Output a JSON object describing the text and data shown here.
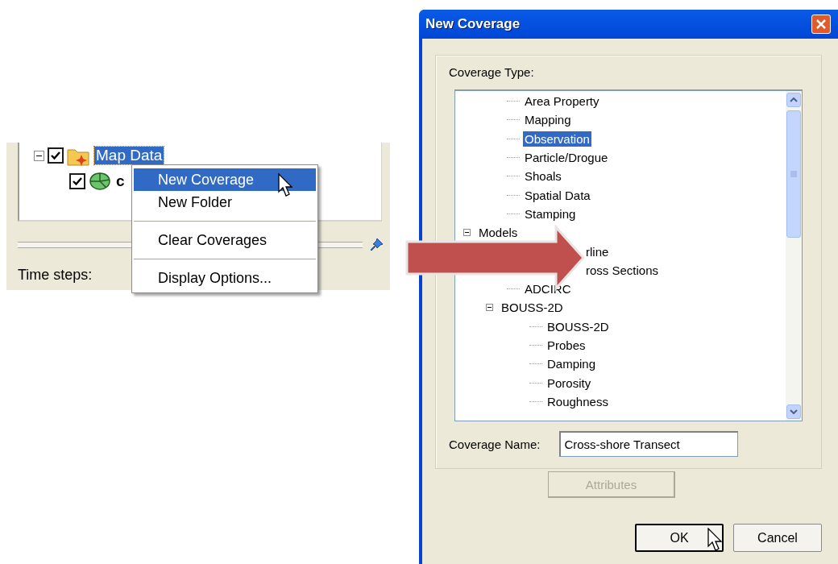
{
  "project_tree": [
    {
      "label": "Map Data",
      "checked": true,
      "selected": true,
      "expanded": true,
      "children": [
        {
          "label": "c",
          "checked": true
        }
      ]
    }
  ],
  "context_menu": {
    "groups": [
      [
        {
          "label": "New Coverage",
          "selected": true
        },
        {
          "label": "New Folder",
          "selected": false
        }
      ],
      [
        {
          "label": "Clear Coverages",
          "selected": false
        }
      ],
      [
        {
          "label": "Display Options...",
          "selected": false
        }
      ]
    ]
  },
  "time_steps_label": "Time steps:",
  "dialog": {
    "title": "New Coverage",
    "coverage_type_label": "Coverage Type:",
    "tree": {
      "scrolled_group": [
        {
          "label": "Area Property",
          "selected": false,
          "kind": "plain"
        },
        {
          "label": "Mapping",
          "selected": false,
          "kind": "plain"
        },
        {
          "label": "Observation",
          "selected": true,
          "kind": "plain"
        },
        {
          "label": "Particle/Drogue",
          "selected": false,
          "kind": "plain"
        },
        {
          "label": "Shoals",
          "selected": false,
          "kind": "plain"
        },
        {
          "label": "Spatial Data",
          "selected": false,
          "kind": "plain"
        },
        {
          "label": "Stamping",
          "selected": false,
          "kind": "plain"
        }
      ],
      "nodes": [
        {
          "label": "Models",
          "selected": false,
          "expanded": true,
          "children": [
            {
              "label": "rline",
              "selected": false,
              "kind": "covered"
            },
            {
              "label": "ross Sections",
              "selected": false,
              "kind": "covered"
            },
            {
              "label": "ADCIRC",
              "selected": false,
              "kind": "plain"
            },
            {
              "label": "BOUSS-2D",
              "selected": false,
              "expanded": true,
              "children": [
                {
                  "label": "BOUSS-2D",
                  "selected": false,
                  "kind": "plain"
                },
                {
                  "label": "Probes",
                  "selected": false,
                  "kind": "plain"
                },
                {
                  "label": "Damping",
                  "selected": false,
                  "kind": "plain"
                },
                {
                  "label": "Porosity",
                  "selected": false,
                  "kind": "plain"
                },
                {
                  "label": "Roughness",
                  "selected": false,
                  "kind": "plain"
                }
              ]
            }
          ]
        }
      ]
    },
    "coverage_name_label": "Coverage Name:",
    "coverage_name": "Cross-shore Transect",
    "attributes_button": {
      "label": "Attributes",
      "disabled": true
    },
    "buttons": [
      {
        "label": "OK",
        "default": true
      },
      {
        "label": "Cancel",
        "default": false
      }
    ]
  }
}
